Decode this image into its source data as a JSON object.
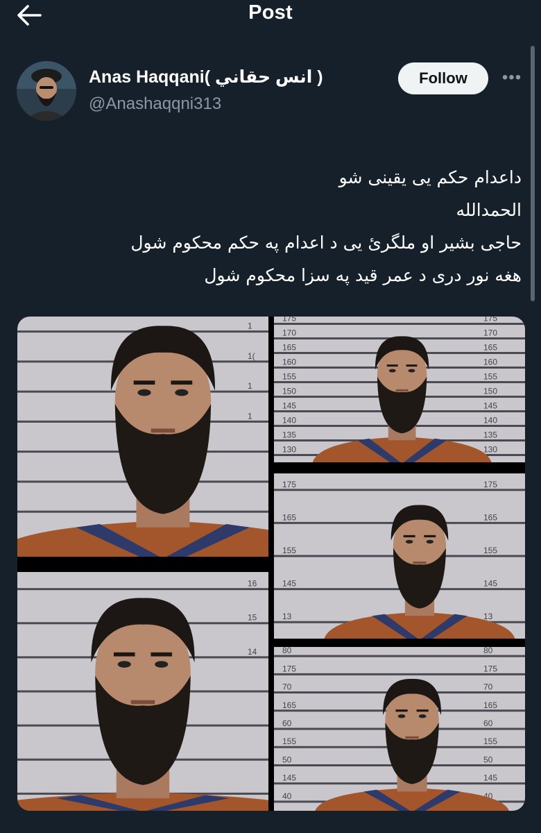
{
  "header": {
    "title": "Post",
    "back_icon": "arrow-left-icon"
  },
  "author": {
    "name": "Anas Haqqani( انس حقاني )",
    "handle": "@Anashaqqni313",
    "follow_label": "Follow",
    "more_icon": "more-horizontal-icon",
    "more_glyph": "•••"
  },
  "post": {
    "lines": [
      "داعدام حکم یی یقینی شو",
      "الحمدالله",
      "حاجی بشیر او ملگرئ یی د اعدام په حکم محکوم شول",
      "هغه نور دری  د عمر قید په سزا محکوم شول"
    ]
  },
  "media": {
    "photo_count": 5,
    "height_chart_left": [
      [
        "1",
        "1(",
        "1",
        "1"
      ],
      [
        "16",
        "15",
        "14"
      ]
    ],
    "height_chart_right": [
      [
        "175",
        "170",
        "165",
        "160",
        "155",
        "150",
        "145",
        "140",
        "135",
        "130"
      ],
      [
        "175",
        "165",
        "155",
        "145",
        "13"
      ],
      [
        "80",
        "175",
        "70",
        "165",
        "60",
        "155",
        "50",
        "145",
        "40"
      ]
    ]
  },
  "colors": {
    "background": "#15202b",
    "secondary_text": "#8b98a5",
    "follow_bg": "#eff3f4",
    "uniform": "#a3552c",
    "straps": "#2d3a6a"
  }
}
